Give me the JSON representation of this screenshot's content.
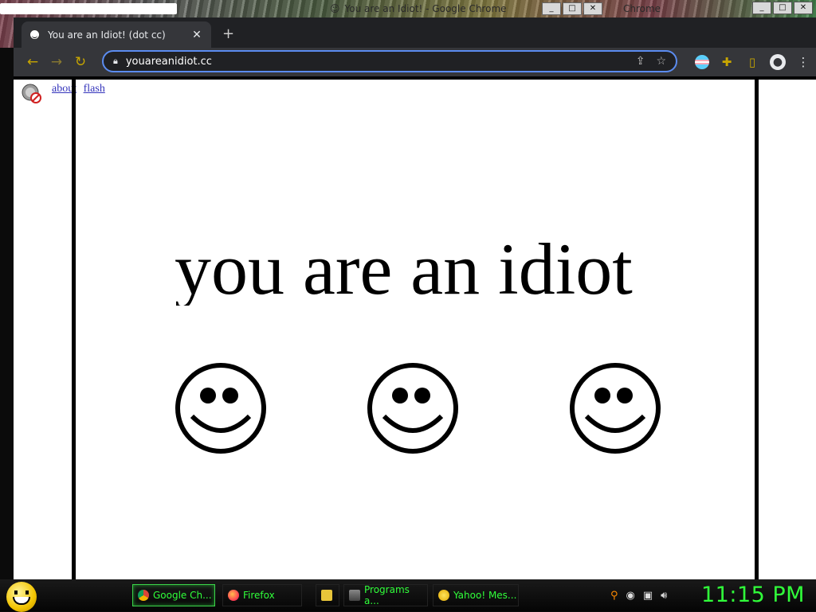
{
  "desktop": {
    "ghost_window_title": "You are an Idiot! - Google Chrome",
    "ghost_window_title_2": "Chrome"
  },
  "browser": {
    "tab_title": "You are an Idiot! (dot cc)",
    "tab_close": "✕",
    "new_tab": "+",
    "url": "youareanidiot.cc",
    "back_icon": "arrow-left",
    "forward_icon": "arrow-right",
    "reload_icon": "reload",
    "window_buttons": [
      "_",
      "□",
      "✕"
    ]
  },
  "page": {
    "links": [
      "about",
      "flash"
    ],
    "headline": "you are an idiot",
    "smiley_count": 3
  },
  "taskbar": {
    "tasks": [
      {
        "label": "Google Ch...",
        "icon": "chrome-icon",
        "active": true
      },
      {
        "label": "Firefox",
        "icon": "firefox-icon",
        "active": false
      },
      {
        "label": "",
        "icon": "folder-icon",
        "active": false
      },
      {
        "label": "Programs a...",
        "icon": "programs-icon",
        "active": false
      },
      {
        "label": "Yahoo! Mes...",
        "icon": "yahoo-messenger-icon",
        "active": false
      }
    ],
    "clock": "11:15 PM"
  },
  "colors": {
    "accent": "#c8a600",
    "clock": "#30ff3a",
    "omnibox_border": "#5b8cf0",
    "link": "#3333bb"
  }
}
